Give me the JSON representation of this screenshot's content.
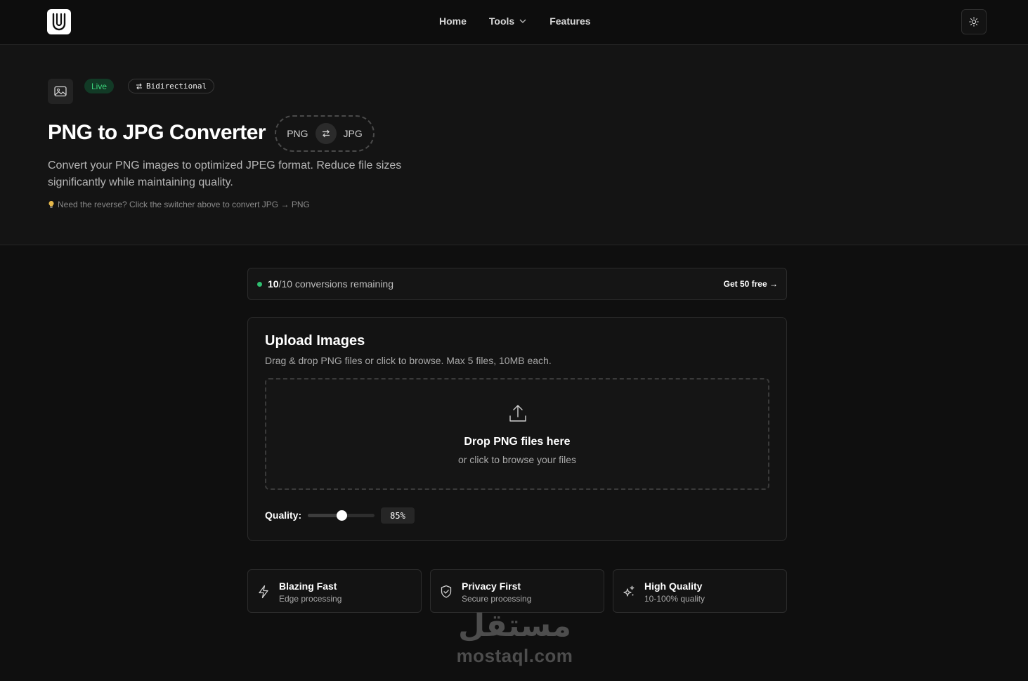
{
  "nav": {
    "links": [
      "Home",
      "Tools",
      "Features"
    ]
  },
  "hero": {
    "badges": {
      "live": "Live",
      "bidirectional": "Bidirectional"
    },
    "title": "PNG to JPG Converter",
    "switcher": {
      "from": "PNG",
      "to": "JPG"
    },
    "description": "Convert your PNG images to optimized JPEG format. Reduce file sizes significantly while maintaining quality.",
    "hint": "Need the reverse? Click the switcher above to convert JPG → PNG"
  },
  "conversions": {
    "remaining": "10",
    "total": "/10 conversions remaining",
    "cta": "Get 50 free →"
  },
  "upload": {
    "title": "Upload Images",
    "subtitle": "Drag & drop PNG files or click to browse. Max 5 files, 10MB each.",
    "drop_title": "Drop PNG files here",
    "drop_subtitle": "or click to browse your files",
    "quality_label": "Quality:",
    "quality_value": "85%",
    "quality_level": 0.5
  },
  "features": [
    {
      "title": "Blazing Fast",
      "subtitle": "Edge processing",
      "icon": "lightning-icon"
    },
    {
      "title": "Privacy First",
      "subtitle": "Secure processing",
      "icon": "shield-check-icon"
    },
    {
      "title": "High Quality",
      "subtitle": "10-100% quality",
      "icon": "sparkles-icon"
    }
  ],
  "watermark": {
    "arabic": "مستقل",
    "latin": "mostaql.com"
  },
  "colors": {
    "accent_green": "#2fbf71",
    "background": "#0f0f0f"
  }
}
